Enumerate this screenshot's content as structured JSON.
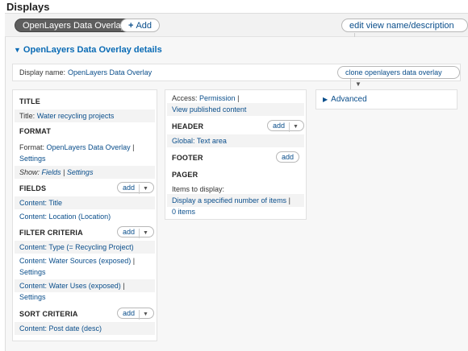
{
  "page": {
    "title": "Displays"
  },
  "topbar": {
    "display_tab": "OpenLayers Data Overlay",
    "add_label": "Add",
    "edit_label": "edit view name/description"
  },
  "details": {
    "heading": "OpenLayers Data Overlay details",
    "display_name_label": "Display name:",
    "display_name_value": "OpenLayers Data Overlay",
    "clone_label": "clone openlayers data overlay"
  },
  "left": {
    "title_heading": "TITLE",
    "title_label": "Title:",
    "title_value": "Water recycling projects",
    "format_heading": "FORMAT",
    "format_label": "Format:",
    "format_value": "OpenLayers Data Overlay",
    "format_sep": "|",
    "format_settings": "Settings",
    "show_label": "Show:",
    "show_value": "Fields",
    "show_sep": "|",
    "show_settings": "Settings",
    "fields_heading": "FIELDS",
    "fields_add": "add",
    "fields": [
      "Content: Title",
      "Content: Location (Location)"
    ],
    "filter_heading": "FILTER CRITERIA",
    "filter_add": "add",
    "filter_1": "Content: Type (= Recycling Project)",
    "filter_2": "Content: Water Sources (exposed)",
    "filter_2_sep": "|",
    "filter_2_settings": "Settings",
    "filter_3": "Content: Water Uses (exposed)",
    "filter_3_sep": "|",
    "filter_3_settings": "Settings",
    "sort_heading": "SORT CRITERIA",
    "sort_add": "add",
    "sort_1": "Content: Post date (desc)"
  },
  "middle": {
    "access_label": "Access:",
    "access_value": "Permission",
    "access_sep": "|",
    "access_value2": "View published content",
    "header_heading": "HEADER",
    "header_add": "add",
    "header_item": "Global: Text area",
    "footer_heading": "FOOTER",
    "footer_add": "add",
    "pager_heading": "PAGER",
    "pager_label": "Items to display:",
    "pager_value": "Display a specified number of items",
    "pager_sep": "|",
    "pager_count": "0 items"
  },
  "right": {
    "advanced_label": "Advanced"
  },
  "colors": {
    "link": "#0a4e8b",
    "heading_link": "#0a6bb5",
    "dark_tab": "#5e5e5e",
    "panel_bg": "#f7f7f7"
  }
}
